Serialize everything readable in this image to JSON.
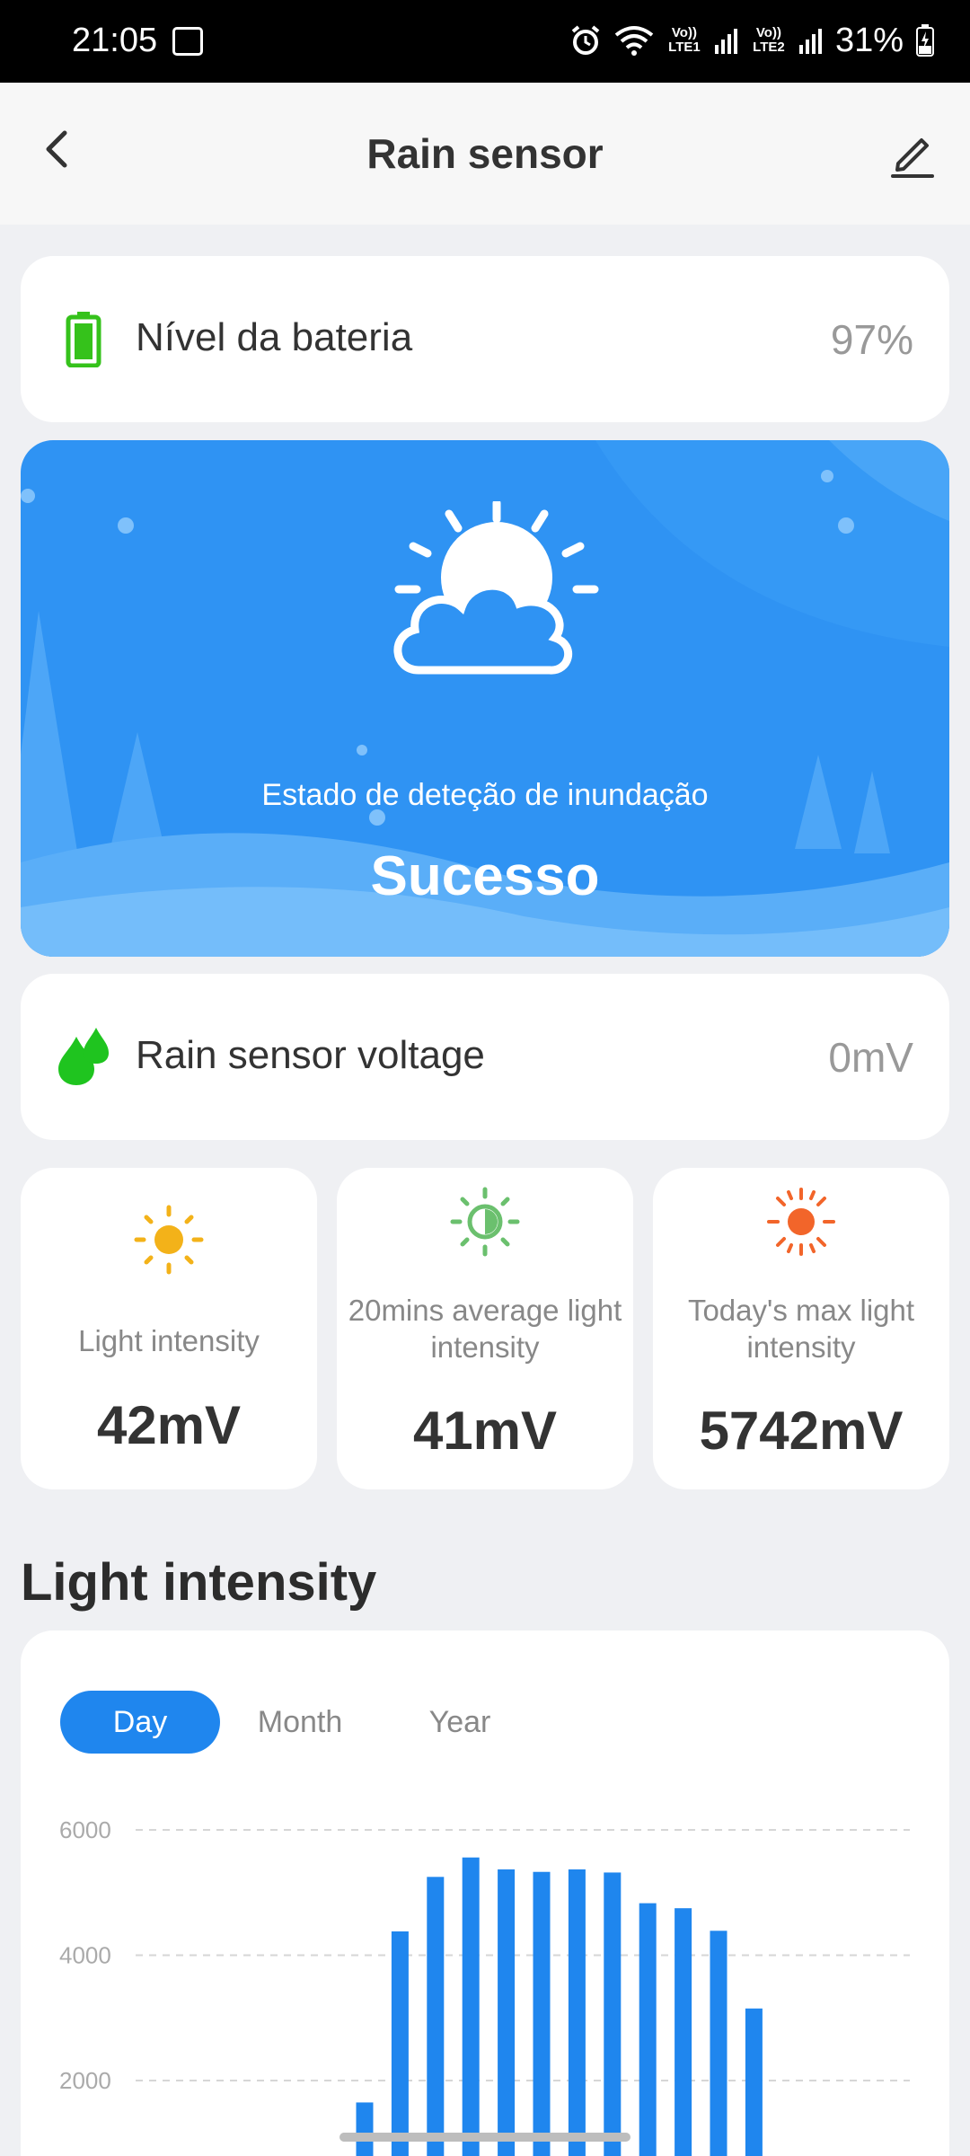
{
  "status_bar": {
    "time": "21:05",
    "net1": "Vo)) LTE1",
    "net2": "Vo)) LTE2",
    "battery": "31%"
  },
  "header": {
    "title": "Rain sensor"
  },
  "battery_row": {
    "label": "Nível da bateria",
    "value": "97%",
    "icon": "battery-icon",
    "color": "#35c21b"
  },
  "hero": {
    "caption": "Estado de deteção de inundação",
    "status": "Sucesso",
    "background": "#2f93f3"
  },
  "voltage_row": {
    "label": "Rain sensor voltage",
    "value": "0mV",
    "icon": "water-drop-icon",
    "color": "#1fc41f"
  },
  "metrics": [
    {
      "label": "Light intensity",
      "value": "42mV",
      "icon": "sun-icon",
      "color": "#f3b219"
    },
    {
      "label": "20mins average light intensity",
      "value": "41mV",
      "icon": "half-sun-icon",
      "color": "#6bc06e"
    },
    {
      "label": "Today's max light intensity",
      "value": "5742mV",
      "icon": "bright-sun-icon",
      "color": "#f2652a"
    }
  ],
  "section": {
    "title": "Light intensity"
  },
  "tabs": [
    "Day",
    "Month",
    "Year"
  ],
  "active_tab": "Day",
  "chart_data": {
    "type": "bar",
    "ylim": [
      0,
      6000
    ],
    "yticks": [
      6000,
      4000,
      2000
    ],
    "grid": true,
    "color": "#1f86ee",
    "values": [
      1650,
      4380,
      5250,
      5560,
      5370,
      5330,
      5370,
      5320,
      4830,
      4750,
      4390,
      3150
    ]
  }
}
